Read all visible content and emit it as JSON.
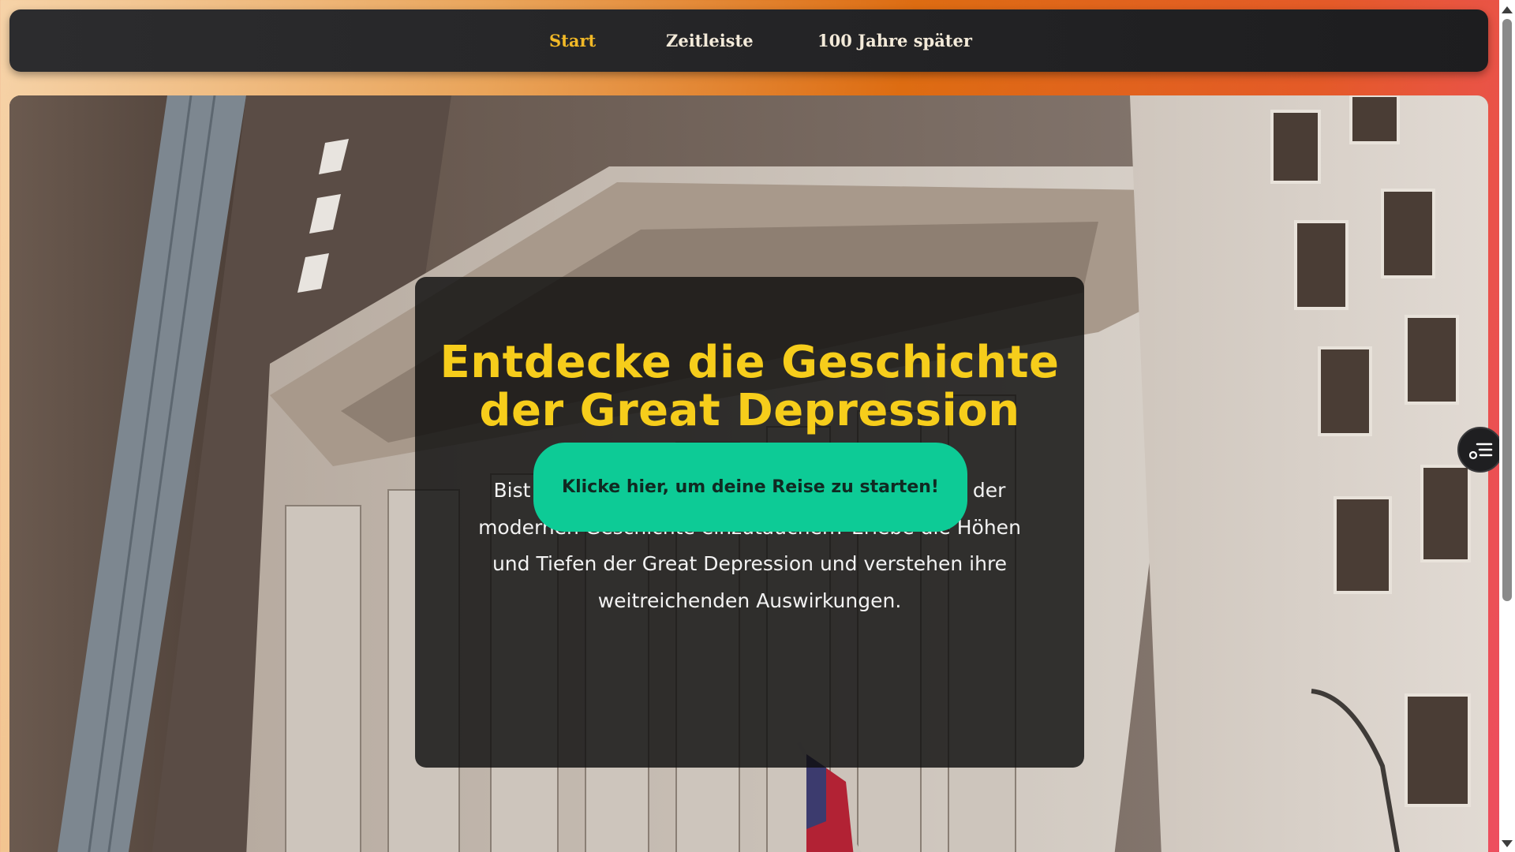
{
  "nav": {
    "items": [
      {
        "label": "Start",
        "active": true
      },
      {
        "label": "Zeitleiste",
        "active": false
      },
      {
        "label": "100 Jahre später",
        "active": false
      }
    ]
  },
  "hero": {
    "title": "Entdecke die Geschichte der Great Depression",
    "text": "Bist du bereit, in eine der prägendsten Epochen der modernen Geschichte einzutauchen? Erlebe die Höhen und Tiefen der Great Depression und verstehen ihre weitreichenden Auswirkungen.",
    "button_label": "Klicke hier, um deine Reise zu starten!",
    "background_image": "photo-stock-exchange-facade-icon"
  },
  "side_toggle": {
    "icon": "menu-list-icon"
  },
  "colors": {
    "accent": "#f6cd1b",
    "nav_active": "#f2b927",
    "button": "#0dcb96",
    "navbar_bg": "#1d1d1f"
  }
}
